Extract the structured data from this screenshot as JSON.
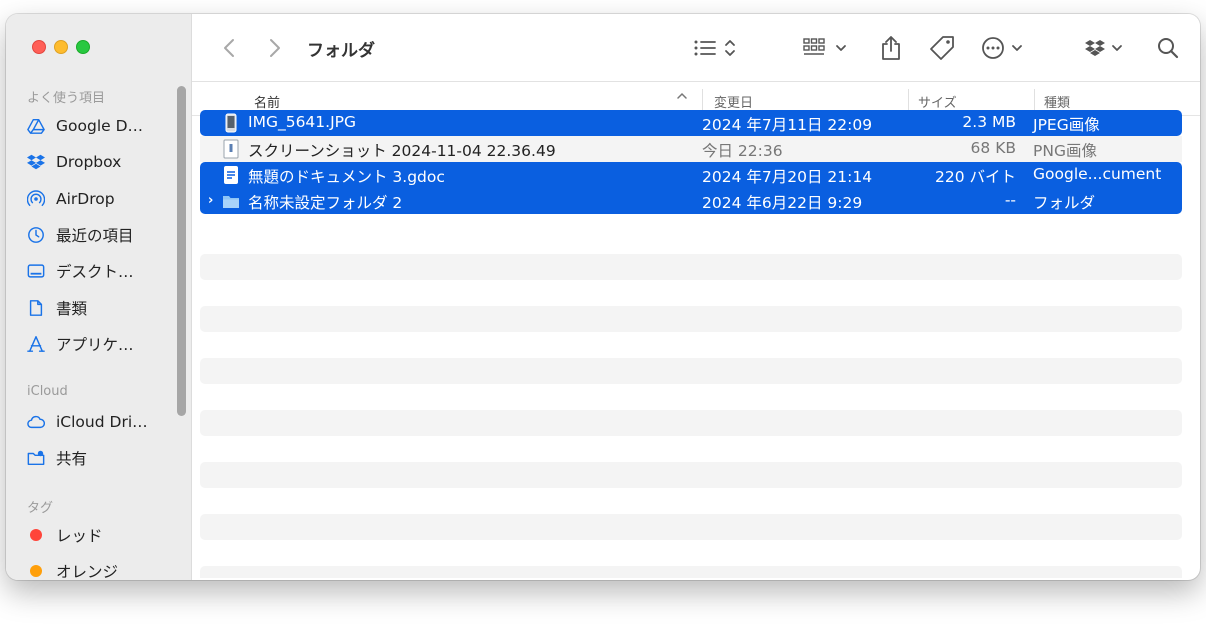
{
  "window": {
    "title": "フォルダ"
  },
  "sidebar": {
    "favorites_title": "よく使う項目",
    "favorites": [
      {
        "label": "Google D…",
        "icon": "google-drive-icon"
      },
      {
        "label": "Dropbox",
        "icon": "dropbox-icon"
      },
      {
        "label": "AirDrop",
        "icon": "airdrop-icon"
      },
      {
        "label": "最近の項目",
        "icon": "clock-icon"
      },
      {
        "label": "デスクト…",
        "icon": "desktop-icon"
      },
      {
        "label": "書類",
        "icon": "document-icon"
      },
      {
        "label": "アプリケ…",
        "icon": "applications-icon"
      }
    ],
    "icloud_title": "iCloud",
    "icloud": [
      {
        "label": "iCloud Dri…",
        "icon": "icloud-icon"
      },
      {
        "label": "共有",
        "icon": "shared-folder-icon"
      }
    ],
    "tags_title": "タグ",
    "tags": [
      {
        "label": "レッド",
        "color": "#ff453a"
      },
      {
        "label": "オレンジ",
        "color": "#ff9f0a"
      }
    ]
  },
  "columns": {
    "name": "名前",
    "date": "変更日",
    "size": "サイズ",
    "kind": "種類"
  },
  "files": [
    {
      "name": "IMG_5641.JPG",
      "date": "2024 年7月11日 22:09",
      "size": "2.3 MB",
      "kind": "JPEG画像",
      "icon": "image-file-icon",
      "selected": true
    },
    {
      "name": "スクリーンショット 2024-11-04 22.36.49",
      "date": "今日 22:36",
      "size": "68 KB",
      "kind": "PNG画像",
      "icon": "png-file-icon",
      "selected": false
    },
    {
      "name": "無題のドキュメント 3.gdoc",
      "date": "2024 年7月20日 21:14",
      "size": "220 バイト",
      "kind": "Google...cument",
      "icon": "gdoc-file-icon",
      "selected": true
    },
    {
      "name": "名称未設定フォルダ 2",
      "date": "2024 年6月22日 9:29",
      "size": "--",
      "kind": "フォルダ",
      "icon": "folder-icon",
      "selected": true,
      "disclosure": "›"
    }
  ],
  "colors": {
    "selection": "#0a5fe0",
    "accent": "#1a73e8"
  }
}
